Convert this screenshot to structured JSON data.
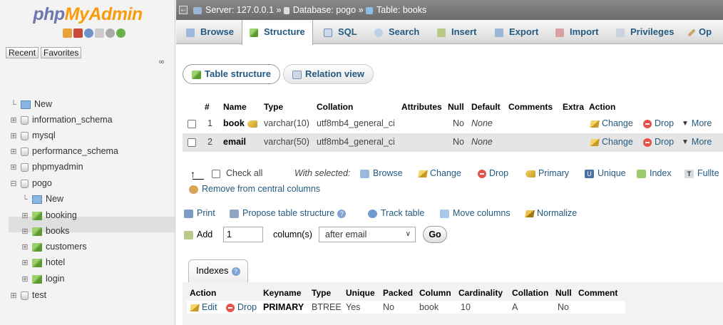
{
  "logo": {
    "part1": "php",
    "part2": "MyAdmin"
  },
  "left": {
    "recent": "Recent",
    "favorites": "Favorites",
    "tree": [
      {
        "label": "New",
        "kind": "new",
        "indent": 0
      },
      {
        "label": "information_schema",
        "kind": "db",
        "indent": 0
      },
      {
        "label": "mysql",
        "kind": "db",
        "indent": 0
      },
      {
        "label": "performance_schema",
        "kind": "db",
        "indent": 0
      },
      {
        "label": "phpmyadmin",
        "kind": "db",
        "indent": 0
      },
      {
        "label": "pogo",
        "kind": "db-open",
        "indent": 0
      },
      {
        "label": "New",
        "kind": "new",
        "indent": 1
      },
      {
        "label": "booking",
        "kind": "table",
        "indent": 1
      },
      {
        "label": "books",
        "kind": "table",
        "indent": 1
      },
      {
        "label": "customers",
        "kind": "table",
        "indent": 1
      },
      {
        "label": "hotel",
        "kind": "table",
        "indent": 1
      },
      {
        "label": "login",
        "kind": "table",
        "indent": 1
      },
      {
        "label": "test",
        "kind": "db",
        "indent": 0
      }
    ]
  },
  "breadcrumb": {
    "server": "Server: 127.0.0.1",
    "sep1": "»",
    "database": "Database: pogo",
    "sep2": "»",
    "table": "Table: books"
  },
  "tabs": [
    "Browse",
    "Structure",
    "SQL",
    "Search",
    "Insert",
    "Export",
    "Import",
    "Privileges",
    "Op"
  ],
  "subtabs": [
    "Table structure",
    "Relation view"
  ],
  "columns_header": {
    "num": "#",
    "name": "Name",
    "type": "Type",
    "collation": "Collation",
    "attributes": "Attributes",
    "null": "Null",
    "default": "Default",
    "comments": "Comments",
    "extra": "Extra",
    "action": "Action"
  },
  "rows": [
    {
      "num": "1",
      "name": "book",
      "type": "varchar(10)",
      "collation": "utf8mb4_general_ci",
      "null": "No",
      "default": "None",
      "change": "Change",
      "drop": "Drop",
      "more": "More"
    },
    {
      "num": "2",
      "name": "email",
      "type": "varchar(50)",
      "collation": "utf8mb4_general_ci",
      "null": "No",
      "default": "None",
      "change": "Change",
      "drop": "Drop",
      "more": "More"
    }
  ],
  "bulk": {
    "check_all": "Check all",
    "with_selected": "With selected:",
    "browse": "Browse",
    "change": "Change",
    "drop": "Drop",
    "primary": "Primary",
    "unique": "Unique",
    "index": "Index",
    "fulltext": "Fullte",
    "remove_central": "Remove from central columns"
  },
  "actions": {
    "print": "Print",
    "propose": "Propose table structure",
    "track": "Track table",
    "move": "Move columns",
    "normalize": "Normalize"
  },
  "add": {
    "label": "Add",
    "count": "1",
    "unit": "column(s)",
    "position": "after email",
    "go": "Go"
  },
  "indexes": {
    "title": "Indexes",
    "headers": {
      "action": "Action",
      "keyname": "Keyname",
      "type": "Type",
      "unique": "Unique",
      "packed": "Packed",
      "column": "Column",
      "cardinality": "Cardinality",
      "collation": "Collation",
      "null": "Null",
      "comment": "Comment"
    },
    "row": {
      "edit": "Edit",
      "drop": "Drop",
      "keyname": "PRIMARY",
      "type": "BTREE",
      "unique": "Yes",
      "packed": "No",
      "column": "book",
      "cardinality": "10",
      "collation": "A",
      "null": "No"
    }
  }
}
